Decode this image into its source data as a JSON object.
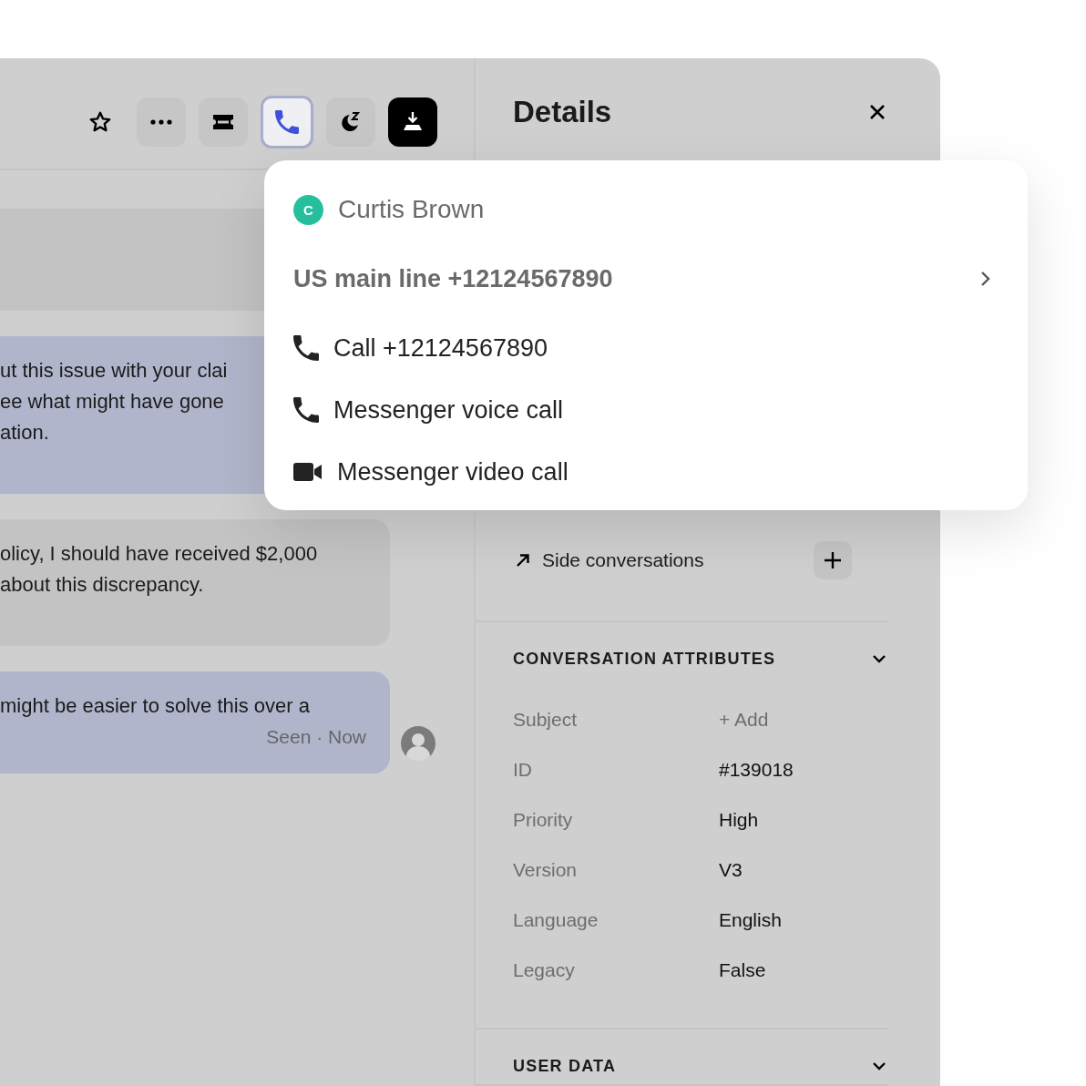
{
  "toolbar": {
    "buttons": [
      {
        "kind": "star",
        "selected": false
      },
      {
        "kind": "more",
        "selected": false
      },
      {
        "kind": "ticket",
        "selected": false
      },
      {
        "kind": "phone",
        "selected": true
      },
      {
        "kind": "snooze",
        "selected": false
      },
      {
        "kind": "tray",
        "selected": false
      }
    ]
  },
  "messages": [
    {
      "kind": "customer"
    },
    {
      "kind": "agent",
      "lines": [
        "ut this issue with your clai",
        "ee what might have gone",
        "ation."
      ]
    },
    {
      "kind": "customer",
      "lines": [
        "olicy, I should have received $2,000",
        "about this discrepancy."
      ],
      "show_avatar": false
    },
    {
      "kind": "agent",
      "lines": [
        "might be easier to solve this over a"
      ],
      "status": "Seen · Now",
      "show_avatar": true
    }
  ],
  "details": {
    "title": "Details",
    "side_conversations": {
      "label": "Side conversations"
    },
    "sections": [
      {
        "title": "CONVERSATION ATTRIBUTES",
        "rows": [
          {
            "label": "Subject",
            "value": "+ Add",
            "kind": "empty"
          },
          {
            "label": "ID",
            "value": "#139018",
            "kind": "set"
          },
          {
            "label": "Priority",
            "value": "High",
            "kind": "set"
          },
          {
            "label": "Version",
            "value": "V3",
            "kind": "set"
          },
          {
            "label": "Language",
            "value": "English",
            "kind": "set"
          },
          {
            "label": "Legacy",
            "value": "False",
            "kind": "set"
          }
        ]
      },
      {
        "title": "USER DATA"
      }
    ]
  },
  "call_menu": {
    "contact": {
      "initial": "C",
      "name": "Curtis Brown"
    },
    "line": "US main line +12124567890",
    "actions": [
      {
        "kind": "phone",
        "label": "Call +12124567890"
      },
      {
        "kind": "phone",
        "label": "Messenger voice call"
      },
      {
        "kind": "video",
        "label": "Messenger video call"
      }
    ]
  }
}
